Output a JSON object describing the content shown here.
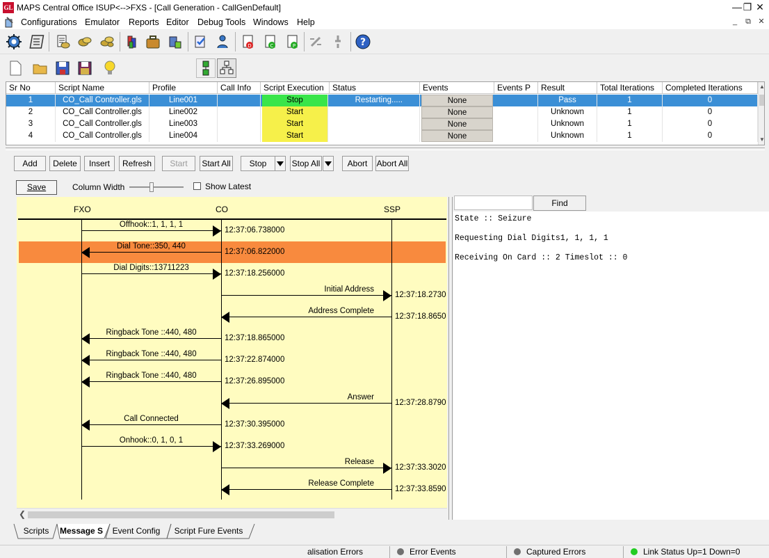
{
  "window": {
    "app_icon_text": "GL",
    "title": "MAPS Central Office ISUP<-->FXS - [Call Generation  - CallGenDefault]",
    "controls": [
      "—",
      "❐",
      "✕"
    ]
  },
  "menu": [
    "Configurations",
    "Emulator",
    "Reports",
    "Editor",
    "Debug Tools",
    "Windows",
    "Help"
  ],
  "mdi_controls": [
    "_",
    "⧉",
    "✕"
  ],
  "grid": {
    "headers": [
      "Sr No",
      "Script Name",
      "Profile",
      "Call Info",
      "Script Execution",
      "Status",
      "Events",
      "Events P",
      "Result",
      "Total Iterations",
      "Completed Iterations"
    ],
    "rows": [
      {
        "sr": "1",
        "script": "CO_Call Controller.gls",
        "profile": "Line001",
        "call_info": "",
        "exec": "Stop",
        "status": "Restarting.....",
        "events": "None",
        "events_p": "",
        "result": "Pass",
        "total": "1",
        "completed": "0",
        "selected": true
      },
      {
        "sr": "2",
        "script": "CO_Call Controller.gls",
        "profile": "Line002",
        "call_info": "",
        "exec": "Start",
        "status": "",
        "events": "None",
        "events_p": "",
        "result": "Unknown",
        "total": "1",
        "completed": "0",
        "selected": false
      },
      {
        "sr": "3",
        "script": "CO_Call Controller.gls",
        "profile": "Line003",
        "call_info": "",
        "exec": "Start",
        "status": "",
        "events": "None",
        "events_p": "",
        "result": "Unknown",
        "total": "1",
        "completed": "0",
        "selected": false
      },
      {
        "sr": "4",
        "script": "CO_Call Controller.gls",
        "profile": "Line004",
        "call_info": "",
        "exec": "Start",
        "status": "",
        "events": "None",
        "events_p": "",
        "result": "Unknown",
        "total": "1",
        "completed": "0",
        "selected": false
      }
    ]
  },
  "buttons": {
    "add": "Add",
    "delete": "Delete",
    "insert": "Insert",
    "refresh": "Refresh",
    "start": "Start",
    "start_all": "Start All",
    "stop": "Stop",
    "stop_all": "Stop All",
    "abort": "Abort",
    "abort_all": "Abort All"
  },
  "ladder_options": {
    "save": "Save",
    "column_width": "Column Width",
    "show_latest": "Show Latest",
    "show_latest_checked": false
  },
  "ladder": {
    "entities": [
      "FXO",
      "CO",
      "SSP"
    ],
    "messages": [
      {
        "label": "Offhook::1, 1, 1, 1",
        "time": "12:37:06.738000",
        "from": 0,
        "to": 1,
        "highlight": false
      },
      {
        "label": "Dial Tone::350, 440",
        "time": "12:37:06.822000",
        "from": 1,
        "to": 0,
        "highlight": true
      },
      {
        "label": "Dial Digits::13711223",
        "time": "12:37:18.256000",
        "from": 0,
        "to": 1,
        "highlight": false
      },
      {
        "label": "Initial Address",
        "time": "12:37:18.2730",
        "from": 1,
        "to": 2,
        "highlight": false
      },
      {
        "label": "Address Complete",
        "time": "12:37:18.8650",
        "from": 2,
        "to": 1,
        "highlight": false
      },
      {
        "label": "Ringback Tone ::440, 480",
        "time": "12:37:18.865000",
        "from": 1,
        "to": 0,
        "highlight": false
      },
      {
        "label": "Ringback Tone ::440, 480",
        "time": "12:37:22.874000",
        "from": 1,
        "to": 0,
        "highlight": false
      },
      {
        "label": "Ringback Tone ::440, 480",
        "time": "12:37:26.895000",
        "from": 1,
        "to": 0,
        "highlight": false
      },
      {
        "label": "Answer",
        "time": "12:37:28.8790",
        "from": 2,
        "to": 1,
        "highlight": false
      },
      {
        "label": "Call Connected",
        "time": "12:37:30.395000",
        "from": 1,
        "to": 0,
        "highlight": false
      },
      {
        "label": "Onhook::0, 1, 0, 1",
        "time": "12:37:33.269000",
        "from": 0,
        "to": 1,
        "highlight": false
      },
      {
        "label": "Release",
        "time": "12:37:33.3020",
        "from": 1,
        "to": 2,
        "highlight": false
      },
      {
        "label": "Release Complete",
        "time": "12:37:33.8590",
        "from": 2,
        "to": 1,
        "highlight": false
      }
    ],
    "colors": {
      "background": "#fffcc0",
      "highlight": "#f88a3e"
    }
  },
  "find": {
    "button": "Find",
    "value": ""
  },
  "log": [
    "State :: Seizure",
    "Requesting Dial Digits1, 1, 1, 1",
    "Receiving On Card :: 2 Timeslot :: 0"
  ],
  "tabs": [
    {
      "label": "Scripts",
      "active": false
    },
    {
      "label": "Message S",
      "active": true
    },
    {
      "label": "Event Config",
      "active": false
    },
    {
      "label": "Script Fure Events",
      "active": false
    }
  ],
  "status": {
    "init_errors": "alisation Errors",
    "error_events": "Error Events",
    "captured_errors": "Captured Errors",
    "link_status": "Link Status Up=1 Down=0"
  },
  "colors": {
    "selected_row": "#3b8fd6",
    "exec_stop": "#39e54a",
    "exec_start": "#f6f04a",
    "link_up": "#22cc22",
    "status_grey": "#707070"
  }
}
